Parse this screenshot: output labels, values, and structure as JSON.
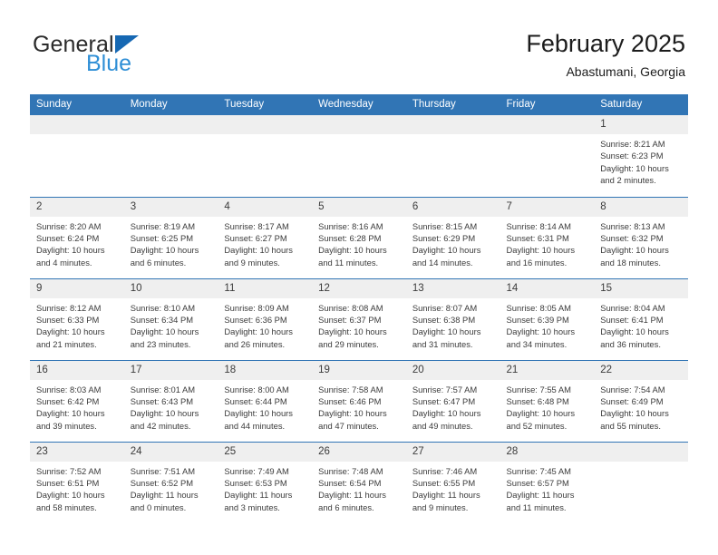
{
  "brand": {
    "name_top": "General",
    "name_bottom": "Blue",
    "triangle_color": "#1668b3",
    "blue_color": "#2f8fd6"
  },
  "header": {
    "month_title": "February 2025",
    "location": "Abastumani, Georgia"
  },
  "theme": {
    "header_blue": "#3175b5",
    "daynum_band": "#efefef",
    "text": "#3b3b3b"
  },
  "weekday_headers": [
    "Sunday",
    "Monday",
    "Tuesday",
    "Wednesday",
    "Thursday",
    "Friday",
    "Saturday"
  ],
  "labels": {
    "sunrise_prefix": "Sunrise:",
    "sunset_prefix": "Sunset:",
    "daylight_prefix": "Daylight:"
  },
  "weeks": [
    [
      {
        "day": "",
        "empty": true
      },
      {
        "day": "",
        "empty": true
      },
      {
        "day": "",
        "empty": true
      },
      {
        "day": "",
        "empty": true
      },
      {
        "day": "",
        "empty": true
      },
      {
        "day": "",
        "empty": true
      },
      {
        "day": "1",
        "sunrise": "Sunrise: 8:21 AM",
        "sunset": "Sunset: 6:23 PM",
        "daylight_line1": "Daylight: 10 hours",
        "daylight_line2": "and 2 minutes."
      }
    ],
    [
      {
        "day": "2",
        "sunrise": "Sunrise: 8:20 AM",
        "sunset": "Sunset: 6:24 PM",
        "daylight_line1": "Daylight: 10 hours",
        "daylight_line2": "and 4 minutes."
      },
      {
        "day": "3",
        "sunrise": "Sunrise: 8:19 AM",
        "sunset": "Sunset: 6:25 PM",
        "daylight_line1": "Daylight: 10 hours",
        "daylight_line2": "and 6 minutes."
      },
      {
        "day": "4",
        "sunrise": "Sunrise: 8:17 AM",
        "sunset": "Sunset: 6:27 PM",
        "daylight_line1": "Daylight: 10 hours",
        "daylight_line2": "and 9 minutes."
      },
      {
        "day": "5",
        "sunrise": "Sunrise: 8:16 AM",
        "sunset": "Sunset: 6:28 PM",
        "daylight_line1": "Daylight: 10 hours",
        "daylight_line2": "and 11 minutes."
      },
      {
        "day": "6",
        "sunrise": "Sunrise: 8:15 AM",
        "sunset": "Sunset: 6:29 PM",
        "daylight_line1": "Daylight: 10 hours",
        "daylight_line2": "and 14 minutes."
      },
      {
        "day": "7",
        "sunrise": "Sunrise: 8:14 AM",
        "sunset": "Sunset: 6:31 PM",
        "daylight_line1": "Daylight: 10 hours",
        "daylight_line2": "and 16 minutes."
      },
      {
        "day": "8",
        "sunrise": "Sunrise: 8:13 AM",
        "sunset": "Sunset: 6:32 PM",
        "daylight_line1": "Daylight: 10 hours",
        "daylight_line2": "and 18 minutes."
      }
    ],
    [
      {
        "day": "9",
        "sunrise": "Sunrise: 8:12 AM",
        "sunset": "Sunset: 6:33 PM",
        "daylight_line1": "Daylight: 10 hours",
        "daylight_line2": "and 21 minutes."
      },
      {
        "day": "10",
        "sunrise": "Sunrise: 8:10 AM",
        "sunset": "Sunset: 6:34 PM",
        "daylight_line1": "Daylight: 10 hours",
        "daylight_line2": "and 23 minutes."
      },
      {
        "day": "11",
        "sunrise": "Sunrise: 8:09 AM",
        "sunset": "Sunset: 6:36 PM",
        "daylight_line1": "Daylight: 10 hours",
        "daylight_line2": "and 26 minutes."
      },
      {
        "day": "12",
        "sunrise": "Sunrise: 8:08 AM",
        "sunset": "Sunset: 6:37 PM",
        "daylight_line1": "Daylight: 10 hours",
        "daylight_line2": "and 29 minutes."
      },
      {
        "day": "13",
        "sunrise": "Sunrise: 8:07 AM",
        "sunset": "Sunset: 6:38 PM",
        "daylight_line1": "Daylight: 10 hours",
        "daylight_line2": "and 31 minutes."
      },
      {
        "day": "14",
        "sunrise": "Sunrise: 8:05 AM",
        "sunset": "Sunset: 6:39 PM",
        "daylight_line1": "Daylight: 10 hours",
        "daylight_line2": "and 34 minutes."
      },
      {
        "day": "15",
        "sunrise": "Sunrise: 8:04 AM",
        "sunset": "Sunset: 6:41 PM",
        "daylight_line1": "Daylight: 10 hours",
        "daylight_line2": "and 36 minutes."
      }
    ],
    [
      {
        "day": "16",
        "sunrise": "Sunrise: 8:03 AM",
        "sunset": "Sunset: 6:42 PM",
        "daylight_line1": "Daylight: 10 hours",
        "daylight_line2": "and 39 minutes."
      },
      {
        "day": "17",
        "sunrise": "Sunrise: 8:01 AM",
        "sunset": "Sunset: 6:43 PM",
        "daylight_line1": "Daylight: 10 hours",
        "daylight_line2": "and 42 minutes."
      },
      {
        "day": "18",
        "sunrise": "Sunrise: 8:00 AM",
        "sunset": "Sunset: 6:44 PM",
        "daylight_line1": "Daylight: 10 hours",
        "daylight_line2": "and 44 minutes."
      },
      {
        "day": "19",
        "sunrise": "Sunrise: 7:58 AM",
        "sunset": "Sunset: 6:46 PM",
        "daylight_line1": "Daylight: 10 hours",
        "daylight_line2": "and 47 minutes."
      },
      {
        "day": "20",
        "sunrise": "Sunrise: 7:57 AM",
        "sunset": "Sunset: 6:47 PM",
        "daylight_line1": "Daylight: 10 hours",
        "daylight_line2": "and 49 minutes."
      },
      {
        "day": "21",
        "sunrise": "Sunrise: 7:55 AM",
        "sunset": "Sunset: 6:48 PM",
        "daylight_line1": "Daylight: 10 hours",
        "daylight_line2": "and 52 minutes."
      },
      {
        "day": "22",
        "sunrise": "Sunrise: 7:54 AM",
        "sunset": "Sunset: 6:49 PM",
        "daylight_line1": "Daylight: 10 hours",
        "daylight_line2": "and 55 minutes."
      }
    ],
    [
      {
        "day": "23",
        "sunrise": "Sunrise: 7:52 AM",
        "sunset": "Sunset: 6:51 PM",
        "daylight_line1": "Daylight: 10 hours",
        "daylight_line2": "and 58 minutes."
      },
      {
        "day": "24",
        "sunrise": "Sunrise: 7:51 AM",
        "sunset": "Sunset: 6:52 PM",
        "daylight_line1": "Daylight: 11 hours",
        "daylight_line2": "and 0 minutes."
      },
      {
        "day": "25",
        "sunrise": "Sunrise: 7:49 AM",
        "sunset": "Sunset: 6:53 PM",
        "daylight_line1": "Daylight: 11 hours",
        "daylight_line2": "and 3 minutes."
      },
      {
        "day": "26",
        "sunrise": "Sunrise: 7:48 AM",
        "sunset": "Sunset: 6:54 PM",
        "daylight_line1": "Daylight: 11 hours",
        "daylight_line2": "and 6 minutes."
      },
      {
        "day": "27",
        "sunrise": "Sunrise: 7:46 AM",
        "sunset": "Sunset: 6:55 PM",
        "daylight_line1": "Daylight: 11 hours",
        "daylight_line2": "and 9 minutes."
      },
      {
        "day": "28",
        "sunrise": "Sunrise: 7:45 AM",
        "sunset": "Sunset: 6:57 PM",
        "daylight_line1": "Daylight: 11 hours",
        "daylight_line2": "and 11 minutes."
      },
      {
        "day": "",
        "empty": true
      }
    ]
  ]
}
